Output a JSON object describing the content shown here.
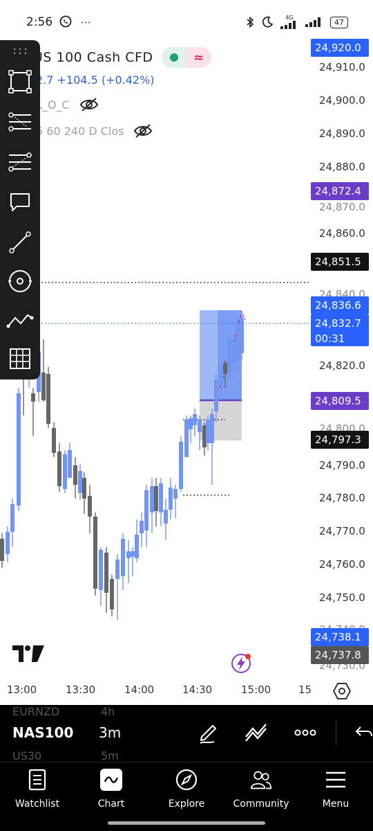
{
  "status_bar": {
    "time": "2:56",
    "more": "⋯",
    "network": "4G",
    "battery": "47"
  },
  "header": {
    "symbol_title": "US 100 Cash CFD",
    "price_change": "2.7 +104.5 (+0.42%)",
    "indicator_1": "L_O_C",
    "indicator_2": "5 60 240 D Clos"
  },
  "colors": {
    "bull": "#7195f0",
    "bear": "#666666",
    "accent_blue": "#2e63d8",
    "purple": "#6a3cc7",
    "position_fill": "#7ea1f5",
    "stop_fill": "#cfcfcf"
  },
  "toolbar": {
    "tools": [
      "select-rectangle-icon",
      "horizontal-lines-icon",
      "pitchfork-icon",
      "comment-icon",
      "trend-line-icon",
      "circle-target-icon",
      "path-icon",
      "grid-icon"
    ]
  },
  "price_scale": {
    "ticks": [
      "24,910.0",
      "24,900.0",
      "24,890.0",
      "24,880.0",
      "24,870.0",
      "24,860.0",
      "24,840.0",
      "24,820.0",
      "24,800.0",
      "24,790.0",
      "24,780.0",
      "24,770.0",
      "24,760.0",
      "24,750.0",
      "24,740.0",
      "24,730.0"
    ],
    "labels": {
      "top_blue": "24,920.0",
      "purple_upper": "24,872.4",
      "black_upper": "24,851.5",
      "blue_upper": "24,836.6",
      "last_price": "24,832.7",
      "countdown": "00:31",
      "purple_lower": "24,809.5",
      "black_lower": "24,797.3",
      "blue_lower": "24,738.1",
      "gray_lower": "24,737.8"
    }
  },
  "time_axis": {
    "labels": [
      "13:00",
      "13:30",
      "14:00",
      "14:30",
      "15:00",
      "15"
    ]
  },
  "symbol_bar": {
    "prev_symbol": "EURNZD",
    "prev_tf": "4h",
    "symbol": "NAS100",
    "timeframe": "3m",
    "next_symbol": "US30",
    "next_tf": "5m"
  },
  "nav": {
    "watchlist": "Watchlist",
    "chart": "Chart",
    "explore": "Explore",
    "community": "Community",
    "menu": "Menu"
  }
}
